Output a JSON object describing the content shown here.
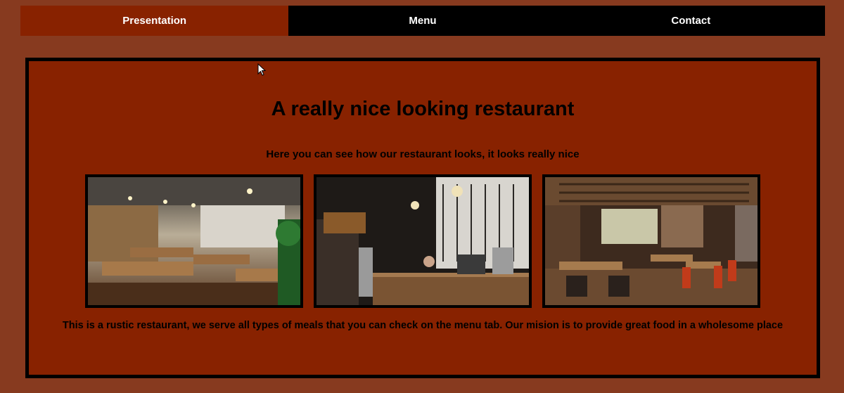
{
  "nav": {
    "tabs": [
      {
        "label": "Presentation",
        "active": true
      },
      {
        "label": "Menu",
        "active": false
      },
      {
        "label": "Contact",
        "active": false
      }
    ]
  },
  "main": {
    "title": "A really nice looking restaurant",
    "subtitle": "Here you can see how our restaurant looks, it looks really nice",
    "description": "This is a rustic restaurant, we serve all types of meals that you can check on the menu tab. Our mision is to provide great food in a wholesome place",
    "photos": [
      {
        "icon": "restaurant-interior-photo-1"
      },
      {
        "icon": "restaurant-bar-photo-2"
      },
      {
        "icon": "restaurant-dining-photo-3"
      }
    ]
  },
  "colors": {
    "page_background": "#873a1f",
    "panel_background": "#882200",
    "active_tab": "#882200",
    "inactive_tab": "#000000",
    "border": "#000000"
  }
}
